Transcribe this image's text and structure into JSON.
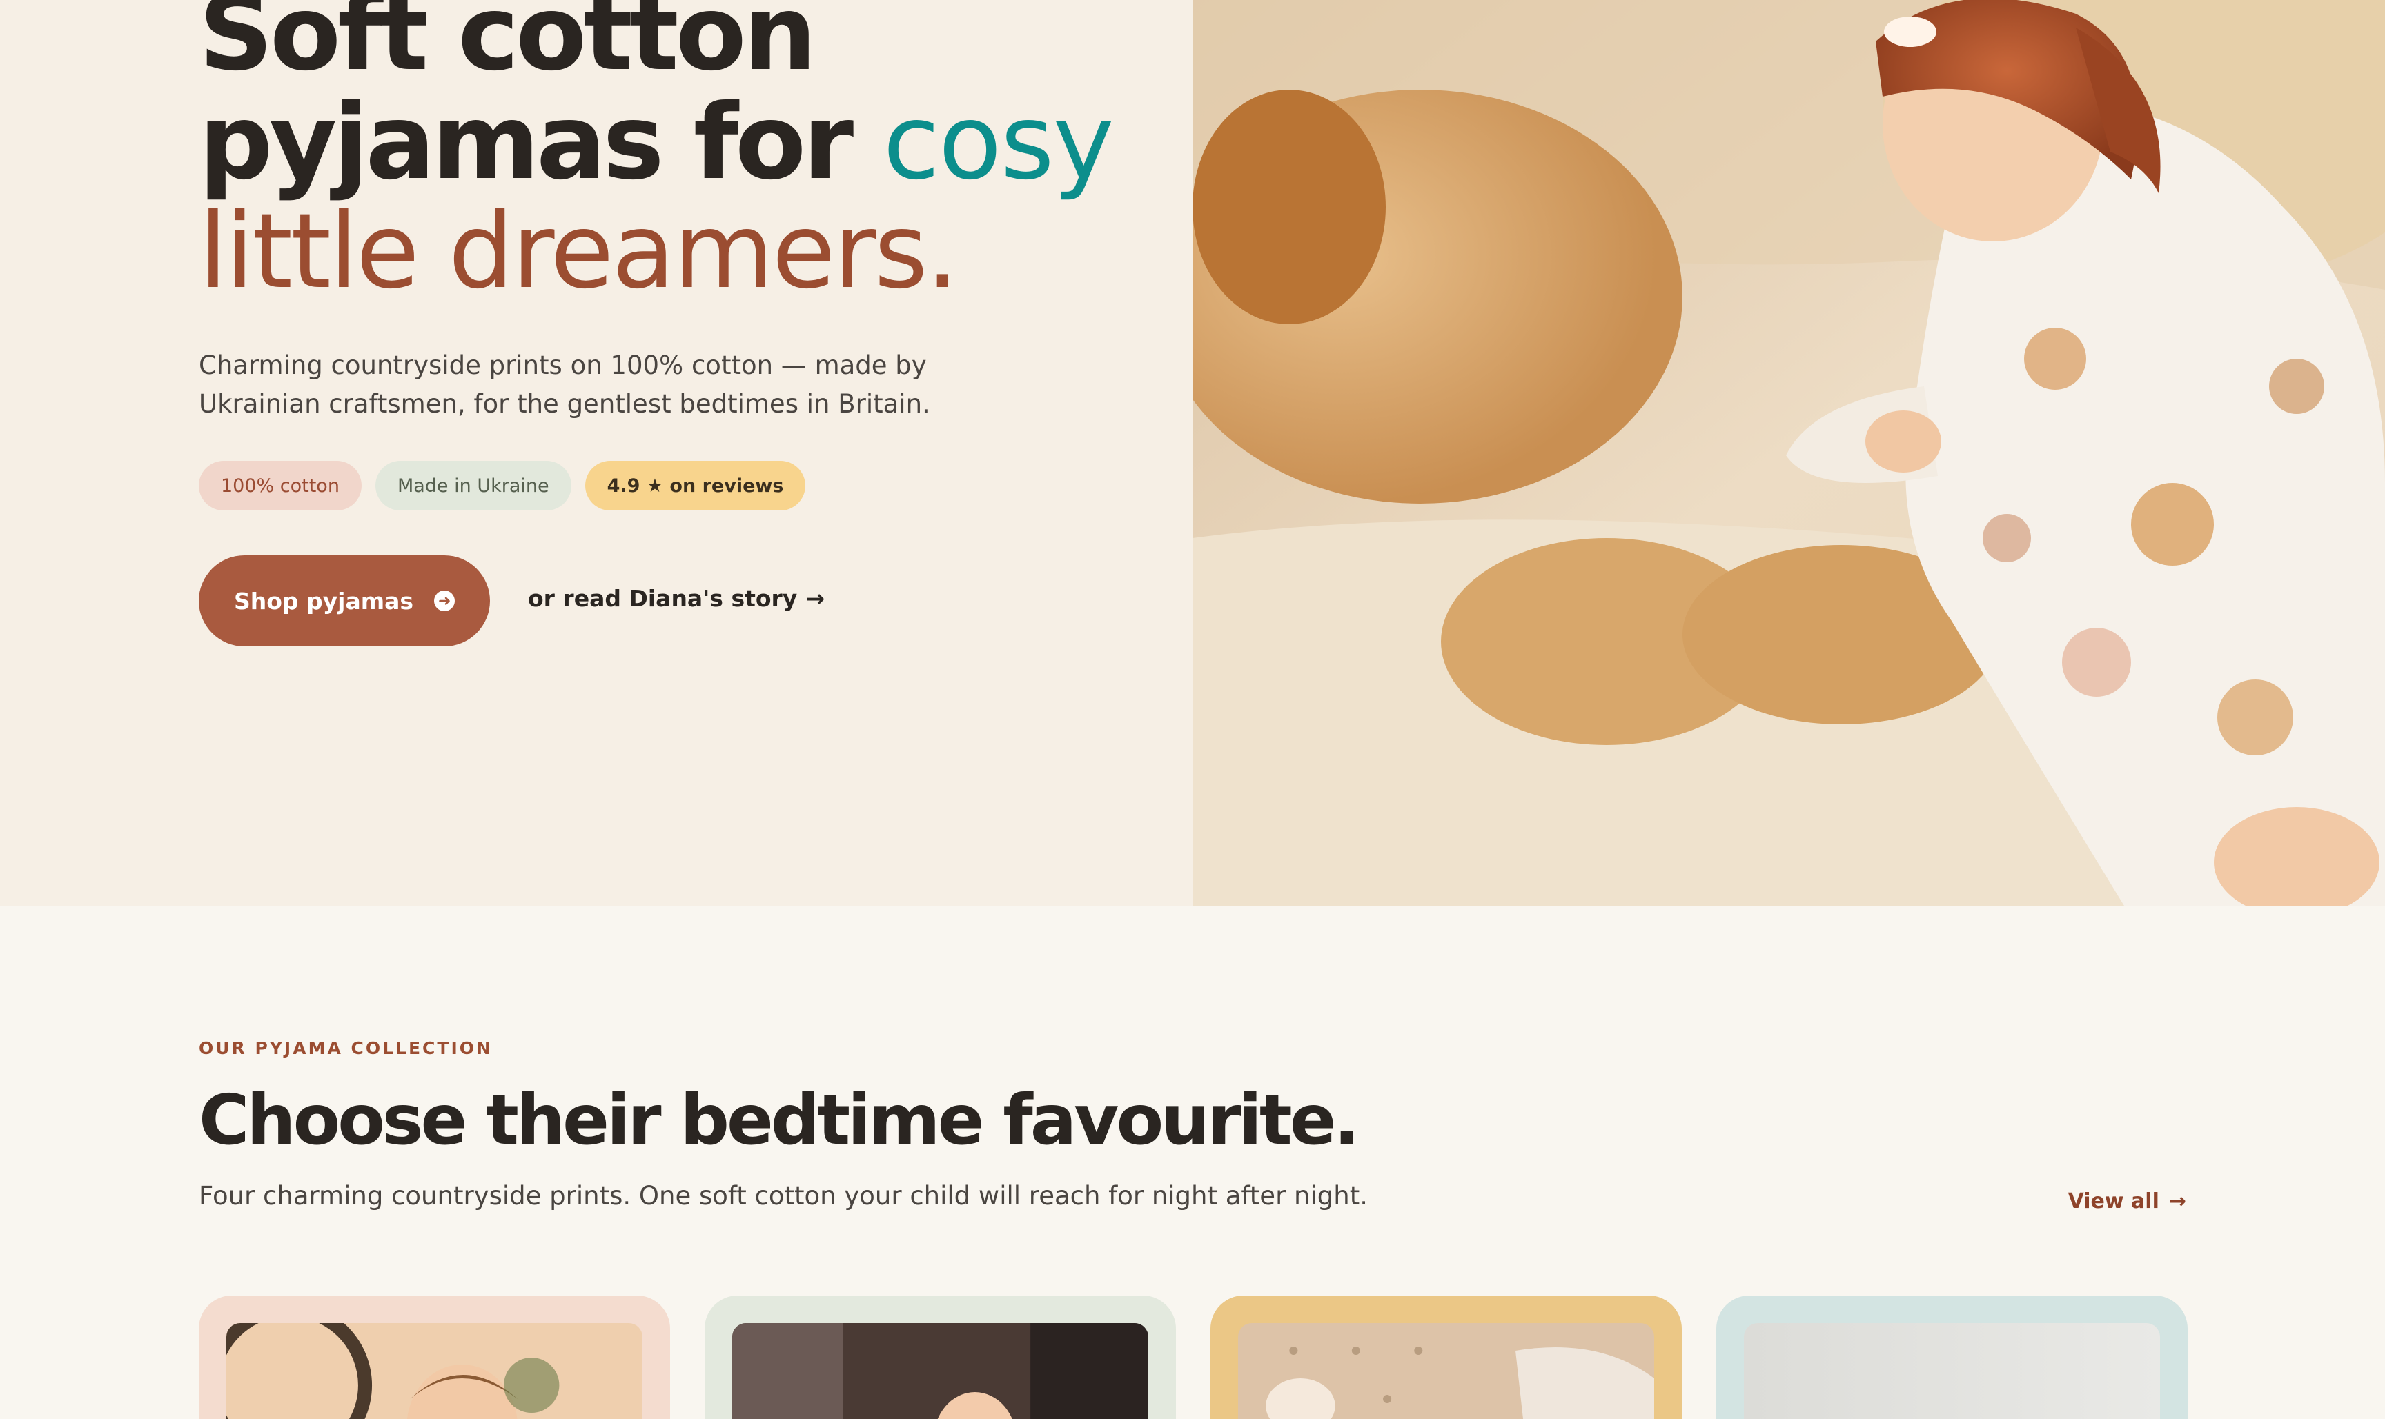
{
  "hero": {
    "headline_line1": "Soft cotton",
    "headline_line2_a": "pyjamas for ",
    "headline_line2_b": "cosy",
    "headline_line3": "little dreamers.",
    "subtitle": "Charming countryside prints on 100% cotton — made by Ukrainian craftsmen, for the gentlest bedtimes in Britain.",
    "pills": [
      "100% cotton",
      "Made in Ukraine",
      "4.9 ★ on reviews"
    ],
    "cta_label": "Shop pyjamas",
    "story_link": "or read Diana's story"
  },
  "collection": {
    "eyebrow": "OUR PYJAMA COLLECTION",
    "title": "Choose their bedtime favourite.",
    "subtitle": "Four charming countryside prints. One soft cotton your child will reach for night after night.",
    "view_all": "View all"
  },
  "colors": {
    "accent_rust": "#a95a3f",
    "accent_teal": "#0c8e8c",
    "hero_bg": "#f6efe5",
    "page_bg": "#f9f6f0"
  }
}
